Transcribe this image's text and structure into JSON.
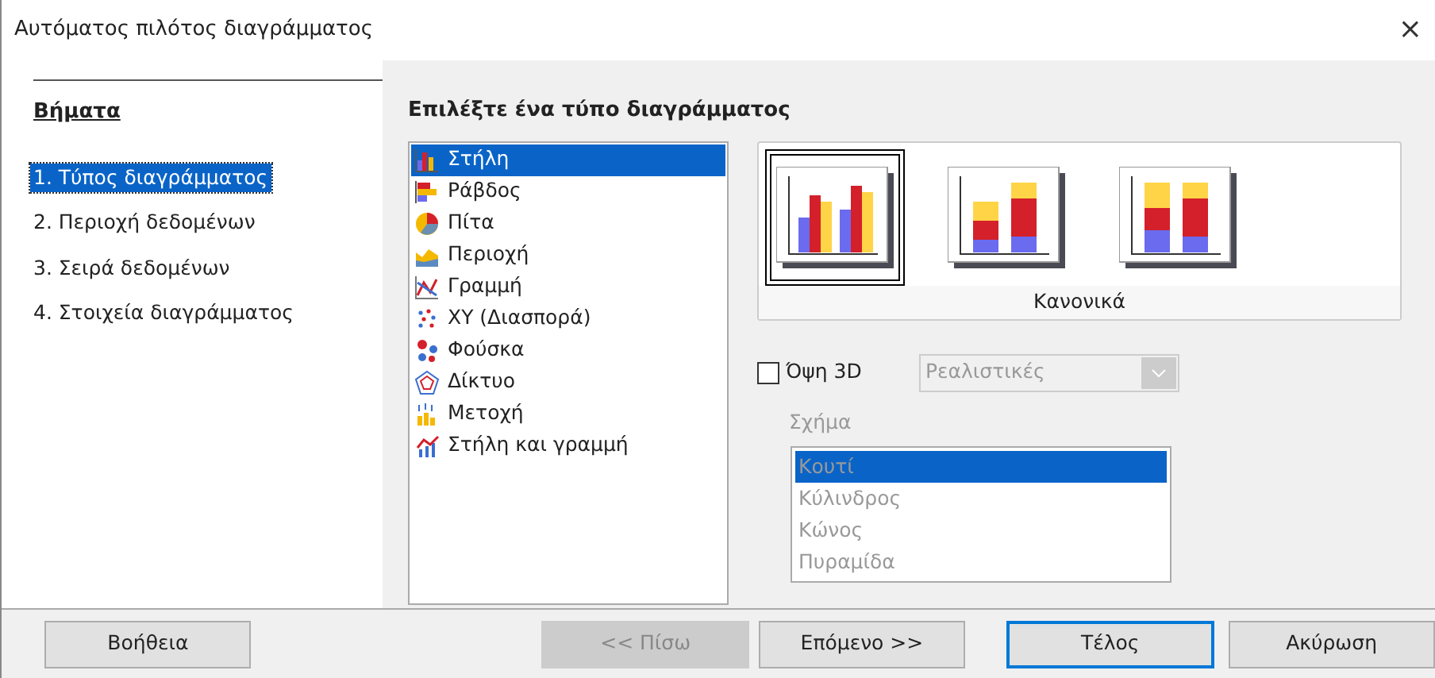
{
  "window": {
    "title": "Αυτόματος πιλότος διαγράμματος",
    "close": "×"
  },
  "steps": {
    "heading": "Βήματα",
    "items": [
      {
        "label": "1. Τύπος διαγράμματος",
        "selected": true
      },
      {
        "label": "2. Περιοχή δεδομένων",
        "selected": false
      },
      {
        "label": "3. Σειρά δεδομένων",
        "selected": false
      },
      {
        "label": "4. Στοιχεία διαγράμματος",
        "selected": false
      }
    ]
  },
  "chart_type": {
    "heading": "Επιλέξτε ένα τύπο διαγράμματος",
    "types": [
      {
        "label": "Στήλη",
        "kind": "column",
        "selected": true
      },
      {
        "label": "Ράβδος",
        "kind": "bar",
        "selected": false
      },
      {
        "label": "Πίτα",
        "kind": "pie",
        "selected": false
      },
      {
        "label": "Περιοχή",
        "kind": "area",
        "selected": false
      },
      {
        "label": "Γραμμή",
        "kind": "line",
        "selected": false
      },
      {
        "label": "XY (Διασπορά)",
        "kind": "xy",
        "selected": false
      },
      {
        "label": "Φούσκα",
        "kind": "bubble",
        "selected": false
      },
      {
        "label": "Δίκτυο",
        "kind": "net",
        "selected": false
      },
      {
        "label": "Μετοχή",
        "kind": "stock",
        "selected": false
      },
      {
        "label": "Στήλη και γραμμή",
        "kind": "columnline",
        "selected": false
      }
    ]
  },
  "subtypes": {
    "items": [
      {
        "kind": "normal",
        "selected": true
      },
      {
        "kind": "stacked",
        "selected": false
      },
      {
        "kind": "percent",
        "selected": false
      }
    ],
    "caption": "Κανονικά"
  },
  "view_3d": {
    "label": "Όψη 3D",
    "checked": false,
    "style": "Ρεαλιστικές",
    "disabled": true
  },
  "shape": {
    "label": "Σχήμα",
    "disabled": true,
    "items": [
      {
        "label": "Κουτί",
        "selected": true
      },
      {
        "label": "Κύλινδρος",
        "selected": false
      },
      {
        "label": "Κώνος",
        "selected": false
      },
      {
        "label": "Πυραμίδα",
        "selected": false
      }
    ]
  },
  "buttons": [
    {
      "label": "Βοήθεια",
      "disabled": false,
      "default": false
    },
    {
      "label": "<< Πίσω",
      "disabled": true,
      "default": false
    },
    {
      "label": "Επόμενο >>",
      "disabled": false,
      "default": false
    },
    {
      "label": "Τέλος",
      "disabled": false,
      "default": true
    },
    {
      "label": "Ακύρωση",
      "disabled": false,
      "default": false
    }
  ]
}
